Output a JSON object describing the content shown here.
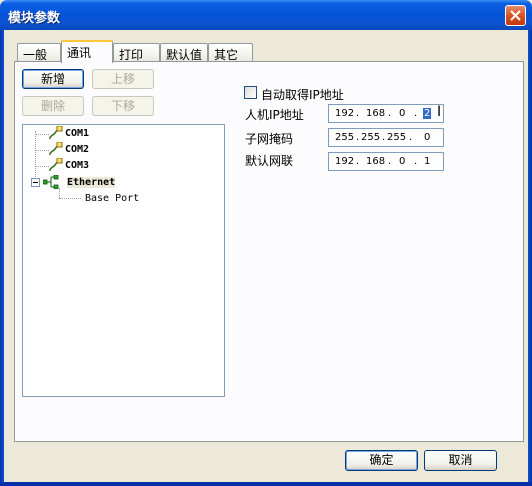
{
  "window": {
    "title": "模块参数"
  },
  "tabs": [
    {
      "label": "一般"
    },
    {
      "label": "通讯"
    },
    {
      "label": "打印"
    },
    {
      "label": "默认值"
    },
    {
      "label": "其它"
    }
  ],
  "active_tab": "通讯",
  "toolbar": {
    "add_label": "新增",
    "move_up_label": "上移",
    "delete_label": "删除",
    "move_down_label": "下移"
  },
  "tree": {
    "items": [
      {
        "label": "COM1",
        "icon": "serial-port-icon"
      },
      {
        "label": "COM2",
        "icon": "serial-port-icon"
      },
      {
        "label": "COM3",
        "icon": "serial-port-icon"
      },
      {
        "label": "Ethernet",
        "icon": "network-icon",
        "expanded": true,
        "children": [
          {
            "label": "Base Port"
          }
        ]
      }
    ]
  },
  "network": {
    "auto_ip_label": "自动取得IP地址",
    "auto_ip_checked": false,
    "hmi_ip_label": "人机IP地址",
    "hmi_ip": [
      "192",
      "168",
      "0",
      "2"
    ],
    "subnet_label": "子网掩码",
    "subnet": [
      "255",
      "255",
      "255",
      "0"
    ],
    "gateway_label": "默认网联",
    "gateway": [
      "192",
      "168",
      "0",
      "1"
    ]
  },
  "footer": {
    "ok_label": "确定",
    "cancel_label": "取消"
  },
  "colors": {
    "titlebar": "#0653D8",
    "dialog_bg": "#ECE9D8",
    "panel_bg": "#FCFCFE",
    "selection": "#316AC5",
    "active_tab_accent": "#FFC83C"
  }
}
